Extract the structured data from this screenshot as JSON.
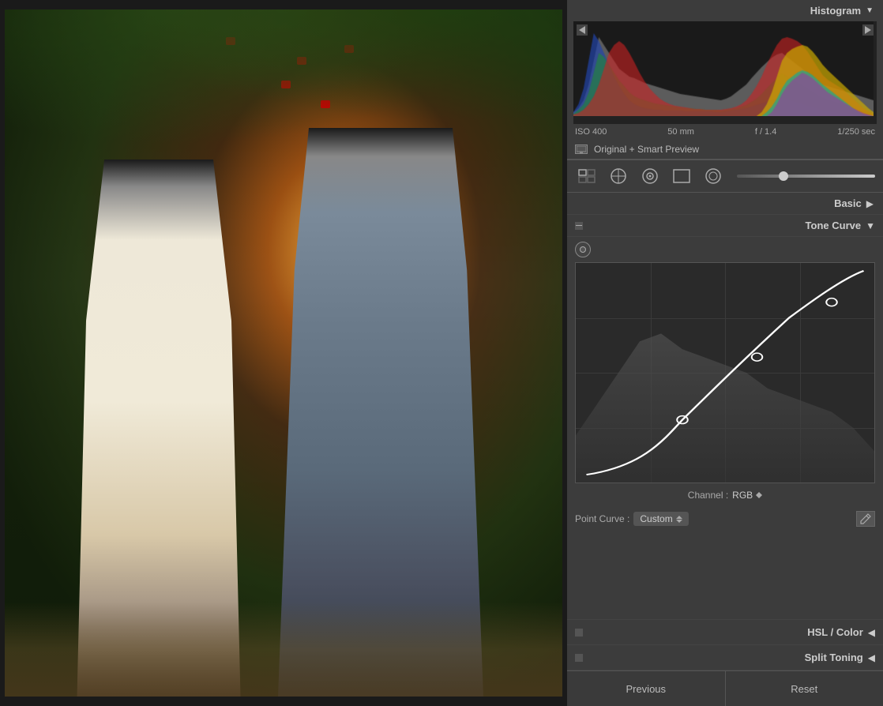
{
  "photo": {
    "alt": "Wedding couple photo"
  },
  "histogram": {
    "title": "Histogram",
    "expand_icon": "▼",
    "clipping_left": "◀",
    "clipping_right": "▶"
  },
  "exif": {
    "iso": "ISO 400",
    "focal": "50 mm",
    "aperture": "f / 1.4",
    "shutter": "1/250 sec"
  },
  "smart_preview": {
    "label": "Original + Smart Preview"
  },
  "tools": {
    "icons": [
      "grid",
      "crop-circle",
      "spot-heal",
      "rect-mask",
      "gradient-mask",
      "brush"
    ]
  },
  "basic": {
    "label": "Basic",
    "arrow": "▶"
  },
  "tone_curve": {
    "title": "Tone Curve",
    "arrow": "▼",
    "channel_label": "Channel :",
    "channel_value": "RGB",
    "point_curve_label": "Point Curve :",
    "point_curve_value": "Custom"
  },
  "hsl": {
    "title": "HSL / Color",
    "arrow": "◀"
  },
  "split_toning": {
    "title": "Split Toning",
    "arrow": "◀"
  },
  "buttons": {
    "previous": "Previous",
    "reset": "Reset"
  }
}
